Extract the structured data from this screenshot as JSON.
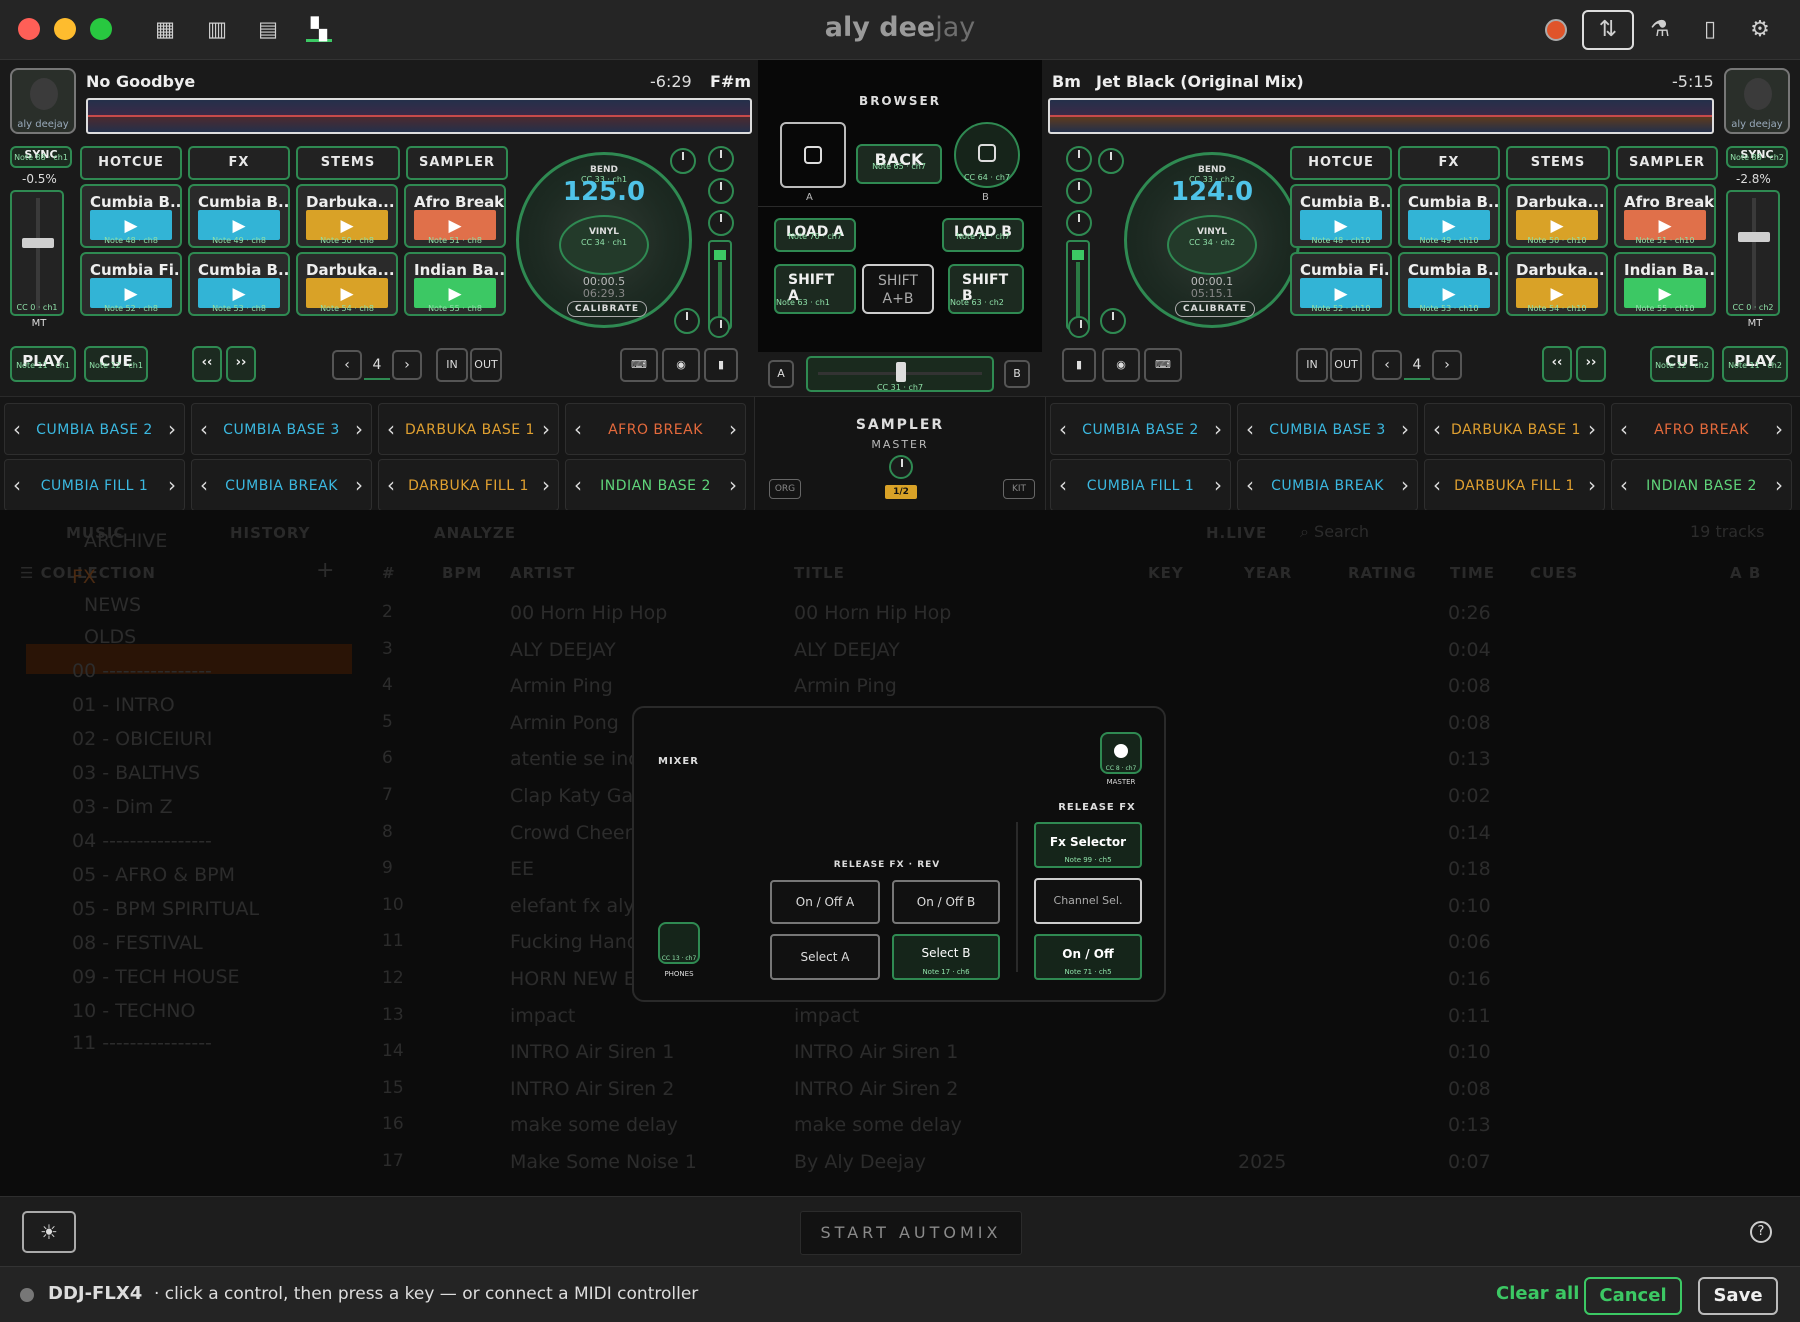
{
  "titlebar": {
    "title_bold": "aly dee",
    "title_light": "jay"
  },
  "deckA": {
    "track_title": "No Goodbye",
    "time": "-6:29",
    "key": "F#m",
    "sync": "SYNC",
    "sync_note": "Note 88 · ch1",
    "pitch": "-0.5%",
    "fader_cc": "CC 0 · ch1",
    "mt": "MT",
    "bpm": "125.0",
    "bend": "BEND",
    "bend_cc": "CC 33 · ch1",
    "vinyl": "VINYL",
    "vinyl_cc": "CC 34 · ch1",
    "elapsed": "00:00.5",
    "remaining": "06:29.3",
    "calibrate": "CALIBRATE",
    "play": "PLAY",
    "play_note": "Note 11 · ch1",
    "cue": "CUE",
    "cue_note": "Note 12 · ch1",
    "loop_size": "4",
    "in": "IN",
    "out": "OUT",
    "avatar": "aly deejay",
    "tabs": [
      "HOTCUE",
      "FX",
      "STEMS",
      "SAMPLER"
    ],
    "pads": [
      {
        "label": "Cumbia B...",
        "note": "Note 48 · ch8",
        "color": "#32b4d6"
      },
      {
        "label": "Cumbia B...",
        "note": "Note 49 · ch8",
        "color": "#32b4d6"
      },
      {
        "label": "Darbuka...",
        "note": "Note 50 · ch8",
        "color": "#d9a227"
      },
      {
        "label": "Afro Break",
        "note": "Note 51 · ch8",
        "color": "#e0704a"
      },
      {
        "label": "Cumbia Fi...",
        "note": "Note 52 · ch8",
        "color": "#32b4d6"
      },
      {
        "label": "Cumbia B...",
        "note": "Note 53 · ch8",
        "color": "#32b4d6"
      },
      {
        "label": "Darbuka...",
        "note": "Note 54 · ch8",
        "color": "#d9a227"
      },
      {
        "label": "Indian Ba...",
        "note": "Note 55 · ch8",
        "color": "#3cc864"
      }
    ]
  },
  "deckB": {
    "track_title": "Jet Black (Original Mix)",
    "time": "-5:15",
    "key": "Bm",
    "sync": "SYNC",
    "sync_note": "Note 88 · ch2",
    "pitch": "-2.8%",
    "fader_cc": "CC 0 · ch2",
    "mt": "MT",
    "bpm": "124.0",
    "bend": "BEND",
    "bend_cc": "CC 33 · ch2",
    "vinyl": "VINYL",
    "vinyl_cc": "CC 34 · ch2",
    "elapsed": "00:00.1",
    "remaining": "05:15.1",
    "calibrate": "CALIBRATE",
    "play": "PLAY",
    "play_note": "Note 11 · ch2",
    "cue": "CUE",
    "cue_note": "Note 12 · ch2",
    "loop_size": "4",
    "in": "IN",
    "out": "OUT",
    "avatar": "aly deejay",
    "tabs": [
      "HOTCUE",
      "FX",
      "STEMS",
      "SAMPLER"
    ],
    "pads": [
      {
        "label": "Cumbia B...",
        "note": "Note 48 · ch10",
        "color": "#32b4d6"
      },
      {
        "label": "Cumbia B...",
        "note": "Note 49 · ch10",
        "color": "#32b4d6"
      },
      {
        "label": "Darbuka...",
        "note": "Note 50 · ch10",
        "color": "#d9a227"
      },
      {
        "label": "Afro Break",
        "note": "Note 51 · ch10",
        "color": "#e0704a"
      },
      {
        "label": "Cumbia Fi...",
        "note": "Note 52 · ch10",
        "color": "#32b4d6"
      },
      {
        "label": "Cumbia B...",
        "note": "Note 53 · ch10",
        "color": "#32b4d6"
      },
      {
        "label": "Darbuka...",
        "note": "Note 54 · ch10",
        "color": "#d9a227"
      },
      {
        "label": "Indian Ba...",
        "note": "Note 55 · ch10",
        "color": "#3cc864"
      }
    ]
  },
  "center": {
    "browser": "BROWSER",
    "back": "BACK",
    "back_note": "Note 65 · ch7",
    "cc64": "CC 64 · ch7",
    "a": "A",
    "b": "B",
    "load_a": "LOAD A",
    "load_a_note": "Note 70 · ch7",
    "load_b": "LOAD B",
    "load_b_note": "Note 71 · ch7",
    "shift_a": "SHIFT",
    "shift_a_sub": "A",
    "shift_a_note": "Note 63 · ch1",
    "shift_ab": "SHIFT",
    "shift_ab_sub": "A+B",
    "shift_b": "SHIFT",
    "shift_b_sub": "B",
    "shift_b_note": "Note 63 · ch2",
    "crossfader_cc": "CC 31 · ch7"
  },
  "samplers_left": [
    [
      "CUMBIA BASE 2",
      "CUMBIA BASE 3",
      "DARBUKA BASE 1",
      "AFRO BREAK"
    ],
    [
      "CUMBIA FILL 1",
      "CUMBIA BREAK",
      "DARBUKA FILL 1",
      "INDIAN BASE 2"
    ]
  ],
  "samplers_right": [
    [
      "CUMBIA BASE 2",
      "CUMBIA BASE 3",
      "DARBUKA BASE 1",
      "AFRO BREAK"
    ],
    [
      "CUMBIA FILL 1",
      "CUMBIA BREAK",
      "DARBUKA FILL 1",
      "INDIAN BASE 2"
    ]
  ],
  "sampler_colors": [
    "#3bb8e0",
    "#3bb8e0",
    "#e0a030",
    "#e46a3c"
  ],
  "sampler_colors2": [
    "#3bb8e0",
    "#3bb8e0",
    "#e0a030",
    "#5fd47a"
  ],
  "sampler_center": {
    "title": "SAMPLER",
    "master": "MASTER",
    "ratio": "1/2",
    "org": "ORG",
    "kit": "KIT"
  },
  "library": {
    "tabs": [
      "MUSIC",
      "HISTORY",
      "ANALYZE"
    ],
    "hlive": "H.LIVE",
    "search": "Search",
    "count": "19 tracks",
    "collection": "COLLECTION",
    "folders": [
      "ARCHIVE",
      "FX",
      "NEWS",
      "OLDS",
      "00 ----------------",
      "01 - INTRO",
      "02 - OBICEIURI",
      "03 - BALTHVS",
      "03 - Dim Z",
      "04 ----------------",
      "05 - AFRO & BPM",
      "05 - BPM SPIRITUAL",
      "08 - FESTIVAL",
      "09 - TECH HOUSE",
      "10 - TECHNO",
      "11 ----------------"
    ],
    "columns": [
      "#",
      "BPM",
      "ARTIST",
      "TITLE",
      "KEY",
      "YEAR",
      "RATING",
      "TIME",
      "CUES",
      "A B"
    ],
    "rows": [
      [
        "2",
        "00 Horn Hip Hop",
        "00 Horn Hip Hop",
        "",
        "0:26"
      ],
      [
        "3",
        "ALY DEEJAY",
        "ALY DEEJAY",
        "",
        "0:04"
      ],
      [
        "4",
        "Armin Ping",
        "Armin Ping",
        "",
        "0:08"
      ],
      [
        "5",
        "Armin Pong",
        "",
        "",
        "0:08"
      ],
      [
        "6",
        "atentie se inc",
        "",
        "",
        "0:13"
      ],
      [
        "7",
        "Clap Katy Ga",
        "",
        "",
        "0:02"
      ],
      [
        "8",
        "Crowd Cheer",
        "",
        "",
        "0:14"
      ],
      [
        "9",
        "EE",
        "",
        "",
        "0:18"
      ],
      [
        "10",
        "elefant fx aly",
        "",
        "",
        "0:10"
      ],
      [
        "11",
        "Fucking Hand",
        "",
        "",
        "0:06"
      ],
      [
        "12",
        "HORN NEW E",
        "",
        "",
        "0:16"
      ],
      [
        "13",
        "impact",
        "impact",
        "",
        "0:11"
      ],
      [
        "14",
        "INTRO Air Siren 1",
        "INTRO Air Siren 1",
        "",
        "0:10"
      ],
      [
        "15",
        "INTRO Air Siren 2",
        "INTRO Air Siren 2",
        "",
        "0:08"
      ],
      [
        "16",
        "make some delay",
        "make some delay",
        "",
        "0:13"
      ],
      [
        "17",
        "Make Some Noise 1",
        "By Aly Deejay",
        "2025",
        "0:07"
      ]
    ]
  },
  "mixer": {
    "title": "MIXER",
    "master": "MASTER",
    "master_cc": "CC 8 · ch7",
    "release_fx": "RELEASE FX",
    "release_fx_rev": "RELEASE FX · REV",
    "on_off_a": "On / Off A",
    "on_off_b": "On / Off B",
    "select_a": "Select A",
    "select_b": "Select B",
    "select_b_note": "Note 17 · ch6",
    "fx_selector": "Fx Selector",
    "fx_selector_note": "Note 99 · ch5",
    "channel_sel": "Channel Sel.",
    "on_off": "On / Off",
    "on_off_note": "Note 71 · ch5",
    "phones": "PHONES",
    "phones_cc": "CC 13 · ch7"
  },
  "bottom": {
    "automix": "START AUTOMIX",
    "help": "?"
  },
  "status": {
    "device": "DDJ-FLX4",
    "message": "· click a control, then press a key — or connect a MIDI controller",
    "clear_all": "Clear all",
    "cancel": "Cancel",
    "save": "Save"
  },
  "colors": {
    "accent": "#2f8a52",
    "bpm": "#4fc3e8",
    "sel_folder": "#7a3a10"
  }
}
